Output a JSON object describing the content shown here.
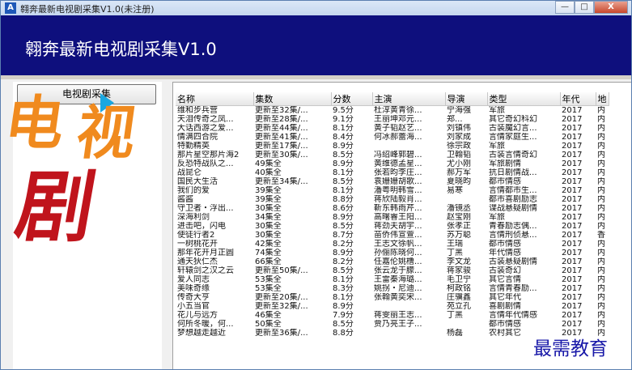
{
  "window": {
    "icon_letter": "A",
    "title": "翱奔最新电视剧采集V1.0(未注册)",
    "minimize": "—",
    "maximize": "□",
    "close": "X"
  },
  "header": {
    "title": "翱奔最新电视剧采集V1.0"
  },
  "sidebar": {
    "button_label": "电视剧采集",
    "logo_chars": [
      "电",
      "视",
      "剧"
    ]
  },
  "table": {
    "columns": [
      "名称",
      "集数",
      "分数",
      "主演",
      "导演",
      "类型",
      "年代",
      "地"
    ],
    "rows": [
      [
        "维和步兵营",
        "更新至32集/...",
        "9.5分",
        "杜淳黄青徐...",
        "宁海强",
        "军旅",
        "2017",
        "内"
      ],
      [
        "天泪传奇之凤...",
        "更新至28集/...",
        "9.1分",
        "王丽坤邓元...",
        "郑...",
        "其它奇幻科幻",
        "2017",
        "内"
      ],
      [
        "大话西游之爱...",
        "更新至44集/...",
        "8.1分",
        "黄子韬赵艺...",
        "刘镇伟",
        "古装魔幻言...",
        "2017",
        "内"
      ],
      [
        "情满四合院",
        "更新至41集/...",
        "8.4分",
        "何冰郝蕾海...",
        "刘家成",
        "言情家庭生...",
        "2017",
        "内"
      ],
      [
        "特勤精英",
        "更新至17集/...",
        "8.9分",
        "",
        "徐宗政",
        "军旅",
        "2017",
        "内"
      ],
      [
        "那片星空那片海2",
        "更新至30集/...",
        "8.5分",
        "冯绍峰郭碧...",
        "卫翰韬",
        "古装言情奇幻",
        "2017",
        "内"
      ],
      [
        "反恐特战队之...",
        "49集全",
        "8.9分",
        "黄维德孟星...",
        "尤小刚",
        "军旅剧情",
        "2017",
        "内"
      ],
      [
        "战昆仑",
        "40集全",
        "8.1分",
        "张若昀李庄...",
        "郝万军",
        "抗日剧情战...",
        "2017",
        "内"
      ],
      [
        "国民大生活",
        "更新至34集/...",
        "8.5分",
        "袁姗姗胡歌...",
        "夏晓昀",
        "都市情感",
        "2017",
        "内"
      ],
      [
        "我们的爱",
        "39集全",
        "8.1分",
        "潘粤明韩雪...",
        "易寒",
        "言情都市生...",
        "2017",
        "内"
      ],
      [
        "酱酱",
        "39集全",
        "8.8分",
        "蒋欣陆毅肖...",
        "",
        "都市喜剧励志",
        "2017",
        "内"
      ],
      [
        "守卫者・浮出...",
        "30集全",
        "8.6分",
        "靳东韩雨芹...",
        "潘镜丞",
        "谍战悬疑剧情",
        "2017",
        "内"
      ],
      [
        "深海利剑",
        "34集全",
        "8.9分",
        "高曙睿王阳...",
        "赵宝刚",
        "军旅",
        "2017",
        "内"
      ],
      [
        "进击吧，闪电",
        "30集全",
        "8.5分",
        "蒋劲夫胡宇...",
        "张孝正",
        "青春励志偶...",
        "2017",
        "内"
      ],
      [
        "使徒行者2",
        "30集全",
        "8.7分",
        "苗侨伟宣萱...",
        "苏万聪",
        "言情刑侦悬...",
        "2017",
        "香"
      ],
      [
        "一树桃花开",
        "42集全",
        "8.2分",
        "王志文徐帆...",
        "王瑞",
        "都市情感",
        "2017",
        "内"
      ],
      [
        "那年花开月正圆",
        "74集全",
        "8.9分",
        "孙俪陈晓何...",
        "丁黑",
        "年代情感",
        "2017",
        "内"
      ],
      [
        "通天狄仁杰",
        "66集全",
        "8.2分",
        "任嘉伦姚橹...",
        "李文龙",
        "古装悬疑剧情",
        "2017",
        "内"
      ],
      [
        "轩辕剑之汉之云",
        "更新至50集/...",
        "8.5分",
        "张云龙于朦...",
        "蒋家骏",
        "古装奇幻",
        "2017",
        "内"
      ],
      [
        "爱人同志",
        "53集全",
        "8.1分",
        "王雷秦海璐...",
        "毛卫宁",
        "其它言情",
        "2017",
        "内"
      ],
      [
        "美味奇缘",
        "53集全",
        "8.3分",
        "姚拐・尼迪...",
        "柯政铭",
        "言情青春励...",
        "2017",
        "内"
      ],
      [
        "传奇大亨",
        "更新至20集/...",
        "8.1分",
        "张翰黄奕宋...",
        "庄骥鑫",
        "其它年代",
        "2017",
        "内"
      ],
      [
        "小五当官",
        "更新至32集/...",
        "8.9分",
        "",
        "苑立孔",
        "喜剧剧情",
        "2017",
        "内"
      ],
      [
        "花儿与远方",
        "46集全",
        "7.9分",
        "蒋雯丽王志...",
        "丁黑",
        "言情年代情感",
        "2017",
        "内"
      ],
      [
        "何所冬暖，何...",
        "50集全",
        "8.5分",
        "贾乃亮王子...",
        "",
        "都市情感",
        "2017",
        "内"
      ],
      [
        "梦想越走越近",
        "更新至36集/...",
        "8.8分",
        "",
        "杨磊",
        "农村其它",
        "2017",
        "内"
      ]
    ]
  },
  "watermark": "最需教育",
  "colors": {
    "header_bg": "#0e0f7d",
    "logo_orange": "#f08a1e",
    "logo_red": "#c0141c",
    "logo_play_blue": "#1aa7e0",
    "watermark_blue": "#1818a8"
  }
}
